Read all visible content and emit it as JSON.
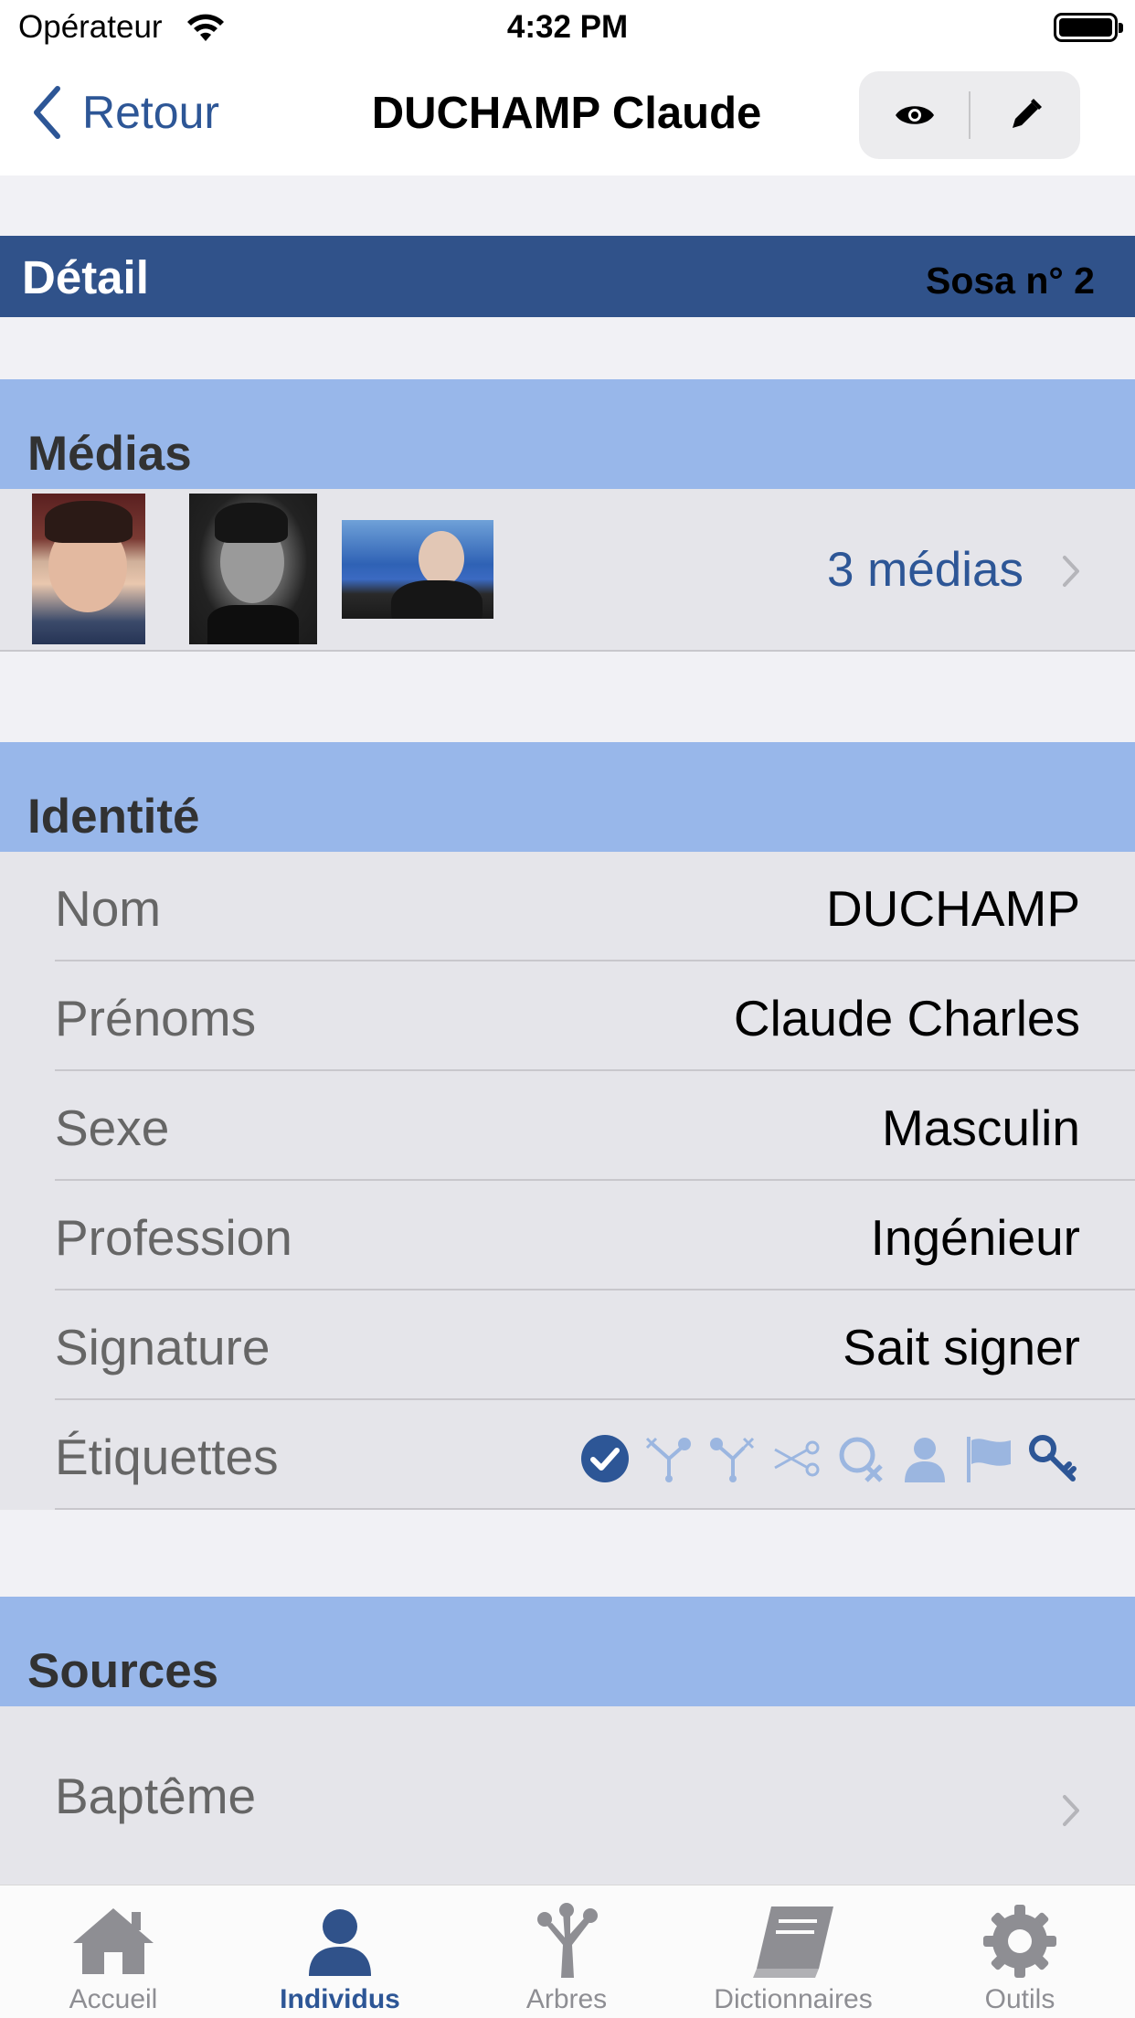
{
  "status_bar": {
    "carrier": "Opérateur",
    "time": "4:32 PM"
  },
  "nav": {
    "back_label": "Retour",
    "title": "DUCHAMP Claude"
  },
  "detail": {
    "title": "Détail",
    "sosa": "Sosa n°  2"
  },
  "media": {
    "header": "Médias",
    "count_label": "3 médias"
  },
  "identity": {
    "header": "Identité",
    "rows": [
      {
        "label": "Nom",
        "value": "DUCHAMP"
      },
      {
        "label": "Prénoms",
        "value": "Claude Charles"
      },
      {
        "label": "Sexe",
        "value": "Masculin"
      },
      {
        "label": "Profession",
        "value": "Ingénieur"
      },
      {
        "label": "Signature",
        "value": "Sait signer"
      }
    ],
    "tags_label": "Étiquettes",
    "tags": [
      "check-circle-icon",
      "branch-icon",
      "branch-x-icon",
      "scissors-icon",
      "search-x-icon",
      "person-icon",
      "flag-icon",
      "key-icon"
    ]
  },
  "sources": {
    "header": "Sources",
    "items": [
      {
        "label": "Baptême"
      }
    ]
  },
  "tabs": [
    {
      "label": "Accueil",
      "icon": "home-icon",
      "active": false
    },
    {
      "label": "Individus",
      "icon": "person-icon",
      "active": true
    },
    {
      "label": "Arbres",
      "icon": "tree-icon",
      "active": false
    },
    {
      "label": "Dictionnaires",
      "icon": "book-icon",
      "active": false
    },
    {
      "label": "Outils",
      "icon": "gear-icon",
      "active": false
    }
  ],
  "colors": {
    "accent": "#2d5696",
    "detail_bar": "#30528a",
    "section_header": "#98b7ea"
  }
}
